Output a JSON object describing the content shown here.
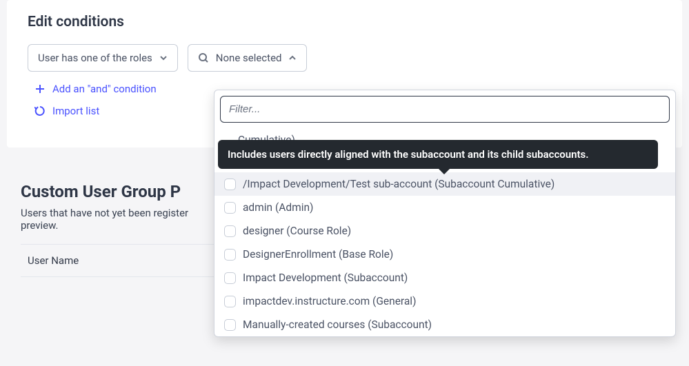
{
  "header": {
    "title": "Edit conditions"
  },
  "condition_select": {
    "label": "User has one of the roles"
  },
  "value_select": {
    "label": "None selected",
    "filter_placeholder": "Filter..."
  },
  "links": {
    "add_and": "Add an \"and\" condition",
    "import_list": "Import list"
  },
  "tooltip": {
    "text": "Includes users directly aligned with the subaccount and its child subaccounts."
  },
  "options": {
    "partial_top": "Cumulative)",
    "items": [
      "/Impact Development/Test sub-account (Subaccount Cumulative)",
      "admin (Admin)",
      "designer (Course Role)",
      "DesignerEnrollment (Base Role)",
      "Impact Development (Subaccount)",
      "impactdev.instructure.com (General)",
      "Manually-created courses (Subaccount)"
    ]
  },
  "preview": {
    "title": "Custom User Group P",
    "subtitle_a": "Users that have not yet been register",
    "subtitle_b": "preview.",
    "col_user_name": "User Name"
  }
}
